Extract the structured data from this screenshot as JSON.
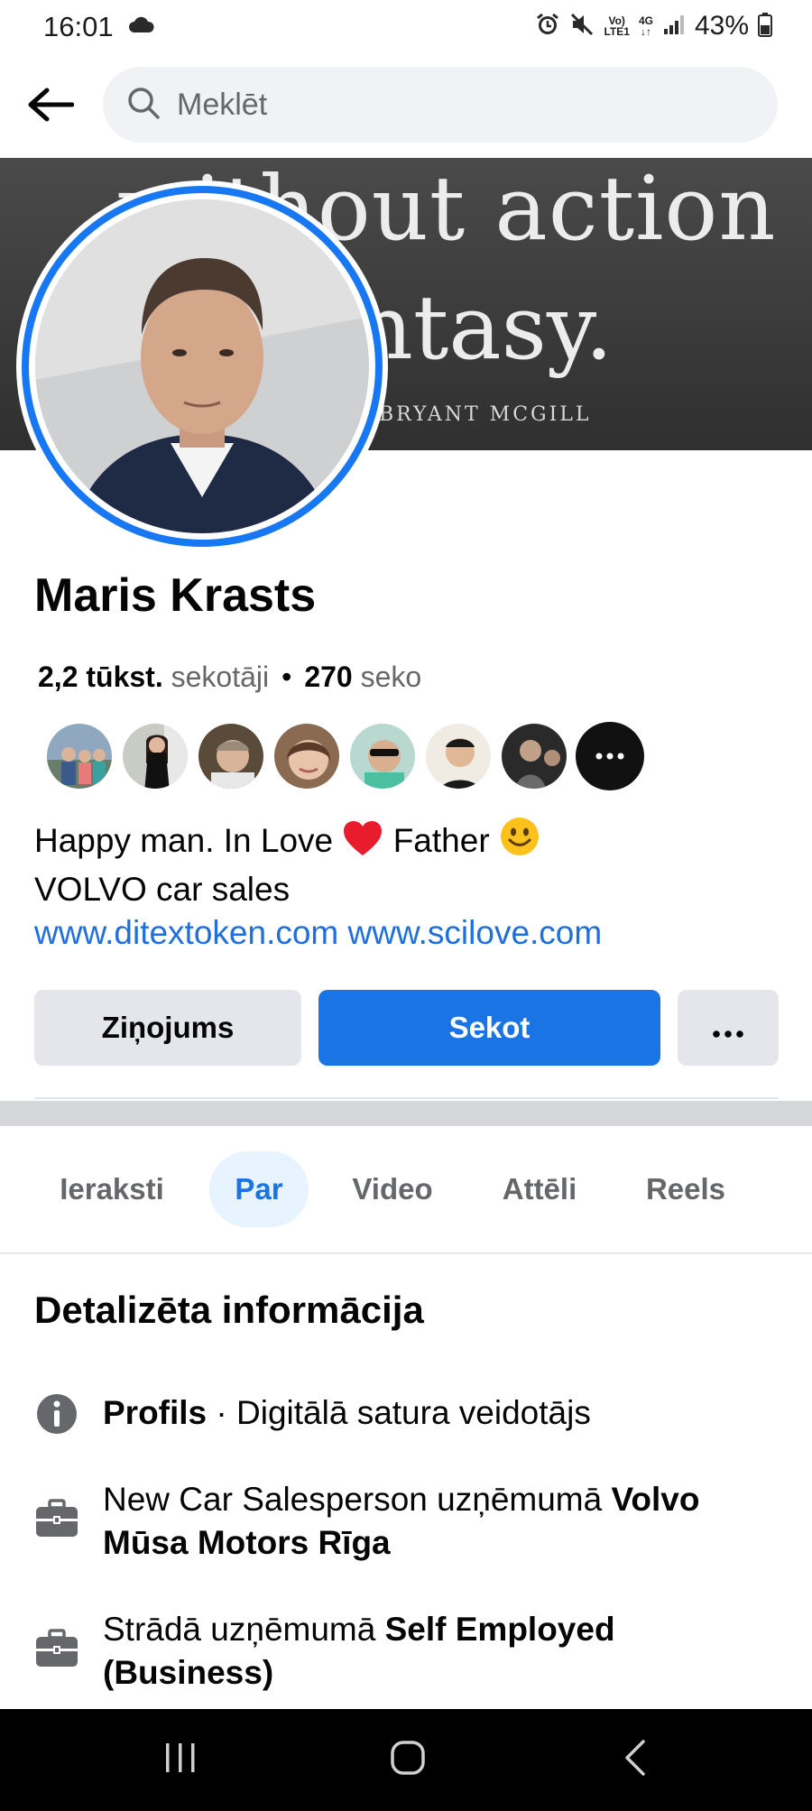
{
  "status_bar": {
    "time": "16:01",
    "network_top": "Vo)",
    "network_bottom": "LTE1",
    "signal_type": "4G",
    "battery": "43%",
    "icons": [
      "cloud-icon",
      "alarm-icon",
      "mute-icon",
      "volte-icon",
      "4g-icon",
      "signal-icon",
      "battery-icon"
    ]
  },
  "header": {
    "search_placeholder": "Meklēt",
    "icons": [
      "back-arrow-icon",
      "search-icon"
    ]
  },
  "cover": {
    "line1": "without action",
    "line2": "fantasy.",
    "author": "BRYANT MCGILL"
  },
  "profile": {
    "name": "Maris Krasts",
    "followers_count": "2,2 tūkst.",
    "followers_label": "sekotāji",
    "separator": "•",
    "following_count": "270",
    "following_label": "seko",
    "follower_avatars_shown": 7
  },
  "bio": {
    "line1_a": "Happy man. In Love",
    "line1_b": "Father",
    "line2": "VOLVO car sales",
    "link1": "www.ditextoken.com",
    "link2": "www.scilove.com"
  },
  "actions": {
    "message_label": "Ziņojums",
    "follow_label": "Sekot",
    "more_label": "•••"
  },
  "tabs": [
    {
      "label": "Ieraksti",
      "active": false
    },
    {
      "label": "Par",
      "active": true
    },
    {
      "label": "Video",
      "active": false
    },
    {
      "label": "Attēli",
      "active": false
    },
    {
      "label": "Reels",
      "active": false
    }
  ],
  "details": {
    "title": "Detalizēta informācija",
    "profile_bold": "Profils",
    "profile_rest": " · Digitālā satura veidotājs",
    "job_prefix": "New Car Salesperson uzņēmumā ",
    "job_company": "Volvo Mūsa Motors Rīga",
    "work_prefix": "Strādā uzņēmumā ",
    "work_company": "Self Employed (Business)"
  },
  "colors": {
    "accent": "#1b74e4",
    "link": "#216fdb",
    "secondary_text": "#65676b",
    "button_grey": "#e4e6eb"
  }
}
